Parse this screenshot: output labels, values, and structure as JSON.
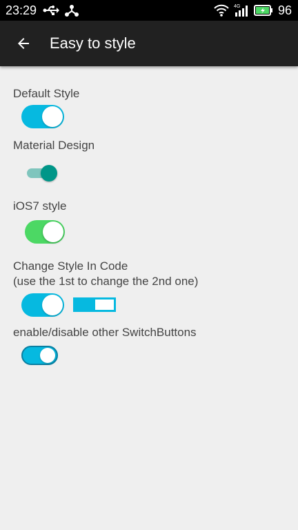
{
  "status_bar": {
    "time": "23:29",
    "battery_level": "96",
    "network_type": "4G",
    "icons": [
      "usb-icon",
      "debug-icon",
      "wifi-icon",
      "signal-icon",
      "battery-icon"
    ]
  },
  "toolbar": {
    "back_icon": "arrow-back-icon",
    "title": "Easy to style"
  },
  "sections": {
    "default_style": {
      "label": "Default Style",
      "checked": true
    },
    "material_design": {
      "label": "Material Design",
      "checked": true
    },
    "ios7_style": {
      "label": "iOS7 style",
      "checked": true
    },
    "change_style": {
      "label_line1": "Change Style In Code",
      "label_line2": "(use the 1st to change the 2nd one)",
      "switch1_checked": true,
      "switch2_checked": true
    },
    "enable_disable": {
      "label": "enable/disable other SwitchButtons",
      "checked": true
    }
  },
  "colors": {
    "status_bar_bg": "#000000",
    "toolbar_bg": "#212121",
    "page_bg": "#efefef",
    "label_text": "#444444",
    "default_accent": "#06b9e0",
    "material_thumb": "#009688",
    "material_track": "#7fc5bd",
    "ios_green": "#4cd864"
  }
}
